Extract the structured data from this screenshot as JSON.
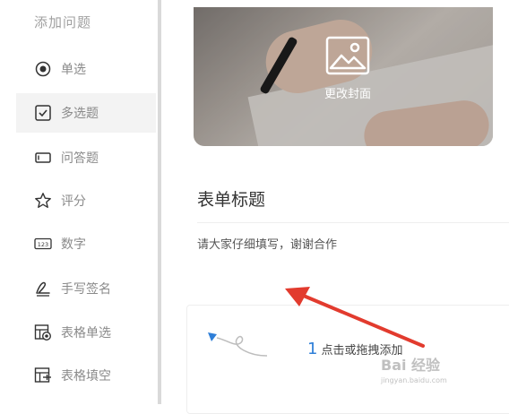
{
  "sidebar": {
    "title": "添加问题",
    "items": [
      {
        "label": "单选",
        "icon": "radio-icon"
      },
      {
        "label": "多选题",
        "icon": "checkbox-icon",
        "active": true
      },
      {
        "label": "问答题",
        "icon": "textbox-icon"
      },
      {
        "label": "评分",
        "icon": "star-icon"
      },
      {
        "label": "数字",
        "icon": "number-icon"
      },
      {
        "label": "手写签名",
        "icon": "signature-icon"
      },
      {
        "label": "表格单选",
        "icon": "table-radio-icon"
      },
      {
        "label": "表格填空",
        "icon": "table-fill-icon"
      }
    ]
  },
  "cover": {
    "change_label": "更改封面",
    "icon": "image-icon"
  },
  "form": {
    "title": "表单标题",
    "description": "请大家仔细填写，谢谢合作"
  },
  "add_area": {
    "number": "1",
    "hint": "点击或拖拽添加"
  },
  "watermark": {
    "main": "Bai 经验",
    "sub": "jingyan.baidu.com"
  },
  "colors": {
    "annotation_arrow": "#e23b2e",
    "accent_blue": "#2f7fd8",
    "sidebar_divider": "#d9d9d9"
  }
}
